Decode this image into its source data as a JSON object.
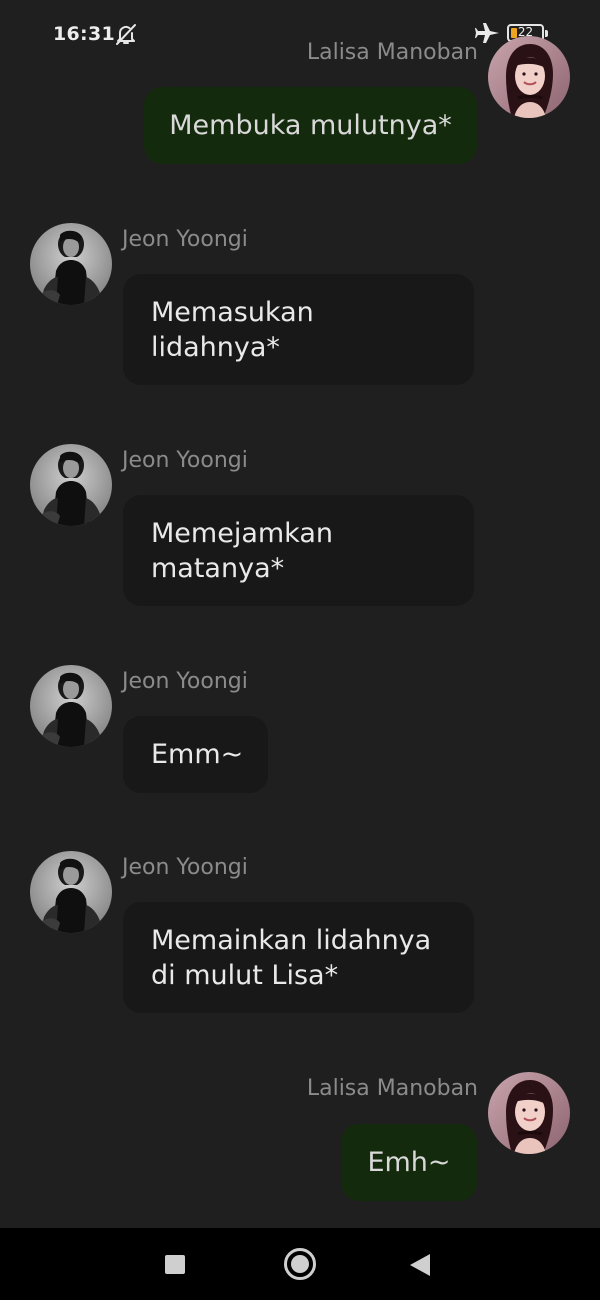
{
  "status_bar": {
    "time": "16:31",
    "battery_level": "22",
    "icons": [
      "bell-off-icon",
      "airplane-mode-icon",
      "battery-icon"
    ],
    "battery_fill_color": "#f0a51e"
  },
  "messages": [
    {
      "sender": "Lalisa Manoban",
      "direction": "outgoing",
      "text": "Membuka mulutnya*"
    },
    {
      "sender": "Jeon Yoongi",
      "direction": "incoming",
      "text": "Memasukan\nlidahnya*"
    },
    {
      "sender": "Jeon Yoongi",
      "direction": "incoming",
      "text": "Memejamkan\nmatanya*"
    },
    {
      "sender": "Jeon Yoongi",
      "direction": "incoming",
      "text": "Emm~"
    },
    {
      "sender": "Jeon Yoongi",
      "direction": "incoming",
      "text": "Memainkan lidahnya\ndi mulut Lisa*"
    },
    {
      "sender": "Lalisa Manoban",
      "direction": "outgoing",
      "text": "Emh~"
    }
  ],
  "colors": {
    "background": "#1f1f1f",
    "incoming_bubble": "#181818",
    "outgoing_bubble": "#142a0d",
    "sender_name": "#8b8b8b"
  },
  "navigation_bar": {
    "buttons": [
      "recents-button",
      "home-button",
      "back-button"
    ]
  }
}
